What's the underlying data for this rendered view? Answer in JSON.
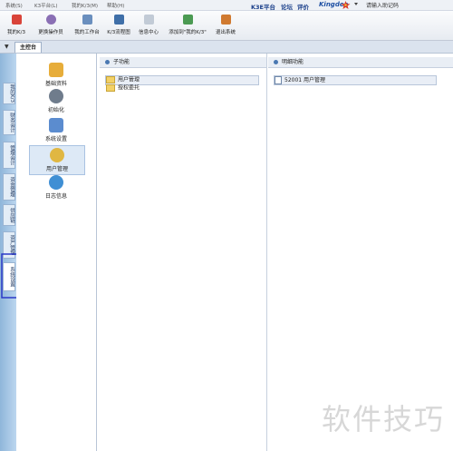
{
  "menubar": {
    "items": [
      "系统(S)",
      "K3平台(L)",
      "我的K/3(M)",
      "帮助(H)"
    ],
    "right_links": [
      "K3E平台",
      "论坛",
      "评价"
    ],
    "brand": "Kingdee",
    "helper_placeholder": "请输入助记码"
  },
  "toolbar": {
    "buttons": [
      "我的K/3",
      "更换操作员",
      "我的工作台",
      "K/3流程图",
      "信息中心",
      "添加到\"我的K/3\"",
      "退出系统"
    ]
  },
  "tabs": {
    "main": "主控台"
  },
  "left_tabs": [
    "我的K/3",
    "财务会计",
    "管理会计",
    "资金管理",
    "供应链",
    "资产管理",
    "系统设置"
  ],
  "nav": {
    "items": [
      "基础资料",
      "初始化",
      "系统设置",
      "用户管理",
      "日志信息"
    ]
  },
  "subfunctions": {
    "header": "子功能",
    "items": [
      "用户管理",
      "授权委托"
    ]
  },
  "details": {
    "header": "明细功能",
    "items": [
      "52001  用户管理"
    ]
  },
  "watermark": "软件技巧",
  "colors": {
    "accent": "#1d4fa3",
    "annotation": "#2b39c8"
  }
}
